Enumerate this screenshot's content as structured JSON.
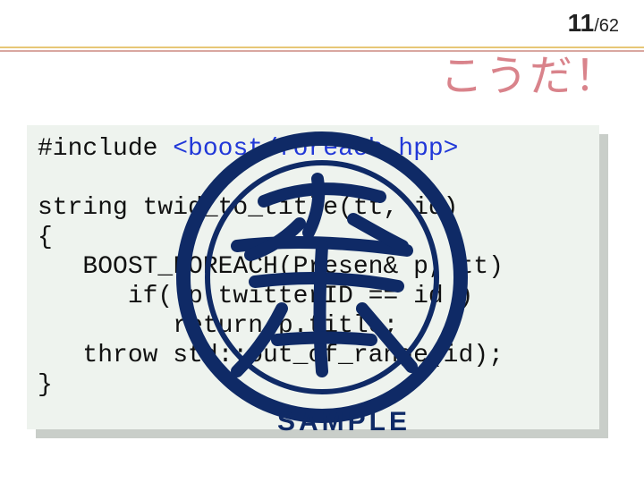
{
  "page": {
    "current": "11",
    "separator": "/",
    "total": "62"
  },
  "title": "こうだ！",
  "code": {
    "line1_prefix": "#include ",
    "line1_header": "<boost/foreach.hpp>",
    "line2": "",
    "line3": "string twid_to_title(tt, id)",
    "line4": "{",
    "line5": "   BOOST_FOREACH(Presen& p, tt)",
    "line6": "      if( p.twitterID == id )",
    "line7": "         return p.title;",
    "line8": "   throw std::out_of_range(id);",
    "line9": "}"
  },
  "sample_label": "SAMPLE"
}
